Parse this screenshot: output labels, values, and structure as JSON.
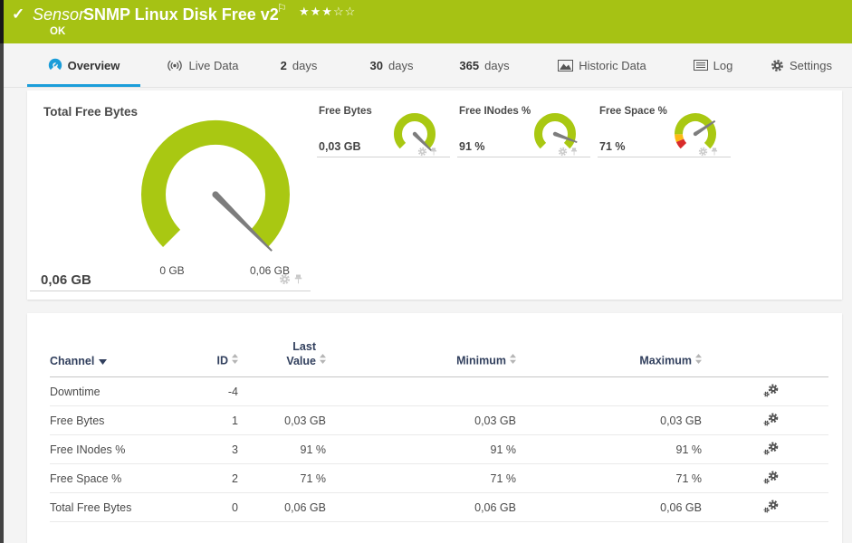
{
  "header": {
    "check": "✓",
    "object_type": "Sensor",
    "sensor_name": "SNMP Linux Disk Free v2",
    "flag": "⚐",
    "stars_filled": "★★★",
    "stars_empty": "☆☆",
    "status": "OK"
  },
  "tabs": {
    "overview": "Overview",
    "live_data": "Live Data",
    "days2_num": "2",
    "days2_unit": "days",
    "days30_num": "30",
    "days30_unit": "days",
    "days365_num": "365",
    "days365_unit": "days",
    "historic": "Historic Data",
    "log": "Log",
    "settings": "Settings"
  },
  "overview": {
    "main_gauge": {
      "title": "Total Free Bytes",
      "value": "0,06 GB",
      "min_label": "0 GB",
      "max_label": "0,06 GB"
    },
    "gauge_free_bytes": {
      "title": "Free Bytes",
      "value": "0,03 GB"
    },
    "gauge_free_inodes": {
      "title": "Free INodes %",
      "value": "91 %"
    },
    "gauge_free_space": {
      "title": "Free Space %",
      "value": "71 %"
    }
  },
  "channels": {
    "headers": {
      "channel": "Channel",
      "id": "ID",
      "last_value": "Last Value",
      "minimum": "Minimum",
      "maximum": "Maximum"
    },
    "rows": [
      {
        "channel": "Downtime",
        "id": "-4",
        "last": "",
        "min": "",
        "max": ""
      },
      {
        "channel": "Free Bytes",
        "id": "1",
        "last": "0,03 GB",
        "min": "0,03 GB",
        "max": "0,03 GB"
      },
      {
        "channel": "Free INodes %",
        "id": "3",
        "last": "91 %",
        "min": "91 %",
        "max": "91 %"
      },
      {
        "channel": "Free Space %",
        "id": "2",
        "last": "71 %",
        "min": "71 %",
        "max": "71 %"
      },
      {
        "channel": "Total Free Bytes",
        "id": "0",
        "last": "0,06 GB",
        "min": "0,06 GB",
        "max": "0,06 GB"
      }
    ]
  },
  "colors": {
    "brand_green": "#a6c214",
    "gauge_green": "#a9c812",
    "accent_blue": "#1b9dd9",
    "warn_orange": "#fdb913",
    "alert_red": "#d92b2b"
  }
}
